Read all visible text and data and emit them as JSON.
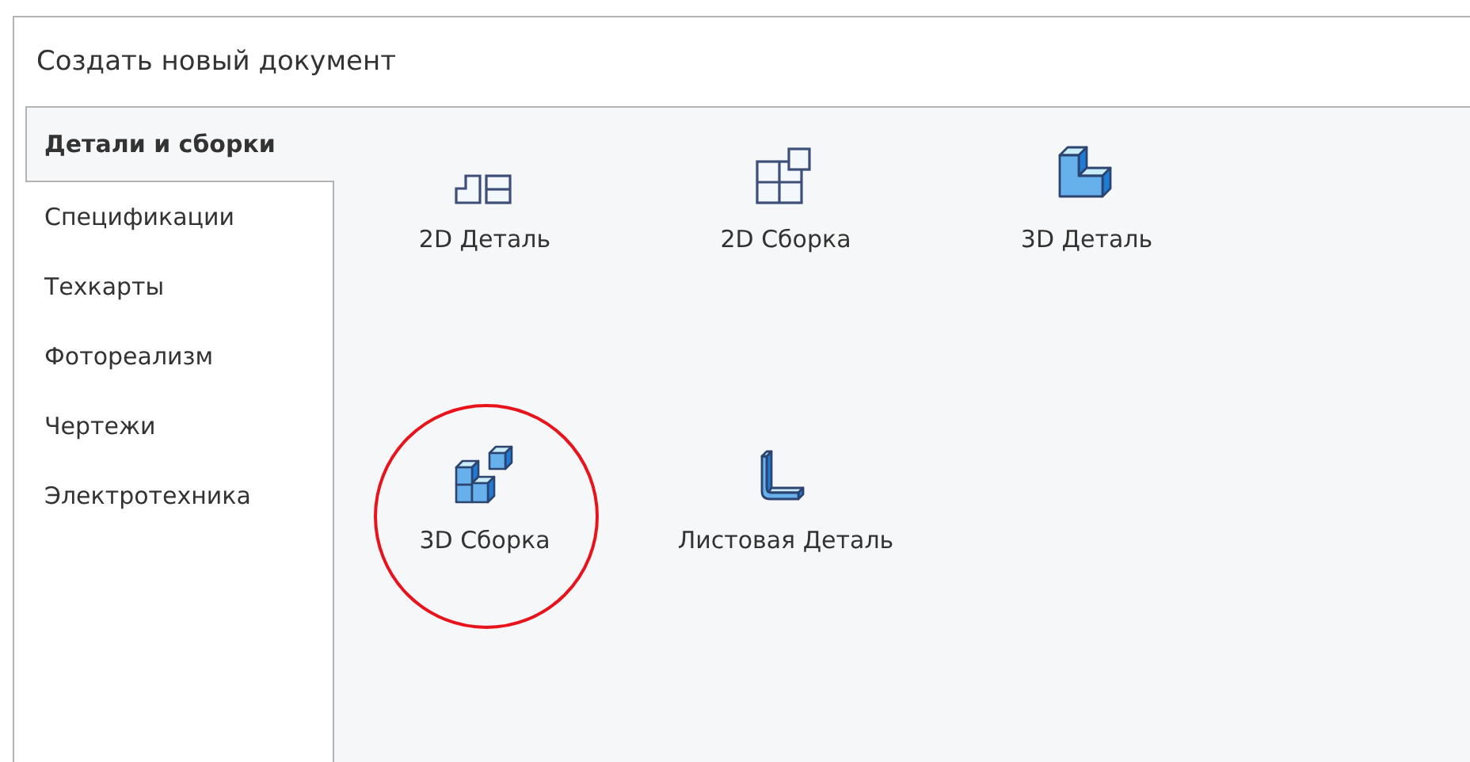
{
  "window": {
    "title": "Создать новый документ"
  },
  "tabs": [
    {
      "label": "Детали и сборки",
      "selected": true
    },
    {
      "label": "Спецификации",
      "selected": false
    },
    {
      "label": "Техкарты",
      "selected": false
    },
    {
      "label": "Фотореализм",
      "selected": false
    },
    {
      "label": "Чертежи",
      "selected": false
    },
    {
      "label": "Электротехника",
      "selected": false
    }
  ],
  "templates": [
    {
      "label": "2D Деталь",
      "kind": "part2d",
      "highlighted": false
    },
    {
      "label": "2D Сборка",
      "kind": "assembly2d",
      "highlighted": false
    },
    {
      "label": "3D Деталь",
      "kind": "part3d",
      "highlighted": false
    },
    {
      "label": "3D Сборка",
      "kind": "assembly3d",
      "highlighted": true
    },
    {
      "label": "Листовая Деталь",
      "kind": "sheet",
      "highlighted": false
    }
  ]
}
